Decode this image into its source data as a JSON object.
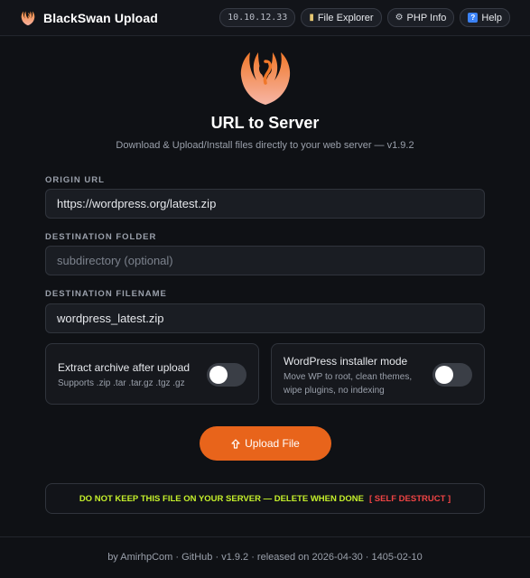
{
  "app": {
    "name": "BlackSwan Upload",
    "accent": "#e8641b"
  },
  "nav": {
    "ip": "10.10.12.33",
    "file_explorer": {
      "icon": "folder-icon",
      "label": "File Explorer"
    },
    "php_info": {
      "icon": "gear-icon",
      "label": "PHP Info"
    },
    "help": {
      "icon": "question-icon",
      "label": "Help"
    }
  },
  "hero": {
    "logo": "swan-icon",
    "title": "URL to Server",
    "subtitle": "Download & Upload/Install files directly to your web server — v1.9.2"
  },
  "form": {
    "origin_url": {
      "label": "ORIGIN URL",
      "value": "https://wordpress.org/latest.zip"
    },
    "destination_folder": {
      "label": "DESTINATION FOLDER",
      "value": "",
      "placeholder": "subdirectory (optional)"
    },
    "destination_filename": {
      "label": "DESTINATION FILENAME",
      "value": "wordpress_latest.zip"
    }
  },
  "options": {
    "extract": {
      "title": "Extract archive after upload",
      "desc": "Supports .zip .tar .tar.gz .tgz .gz",
      "enabled": false
    },
    "wp_installer": {
      "title": "WordPress installer mode",
      "desc_line1": "Move WP to root, clean themes,",
      "desc_line2": "wipe plugins, no indexing",
      "enabled": false
    }
  },
  "upload_button": {
    "icon": "upload-arrow-icon",
    "label": "Upload File"
  },
  "warning": {
    "text": "DO NOT KEEP THIS FILE ON YOUR SERVER — DELETE WHEN DONE",
    "action": "[ SELF DESTRUCT ]",
    "text_color": "#c5f02b",
    "action_color": "#ef4444"
  },
  "footer": {
    "prefix": "by",
    "author": "AmirhpCom",
    "sep1": "·",
    "github": "GitHub",
    "sep2": "·",
    "release": "v1.9.2 · released on 2026-04-30 · 1405-02-10"
  }
}
